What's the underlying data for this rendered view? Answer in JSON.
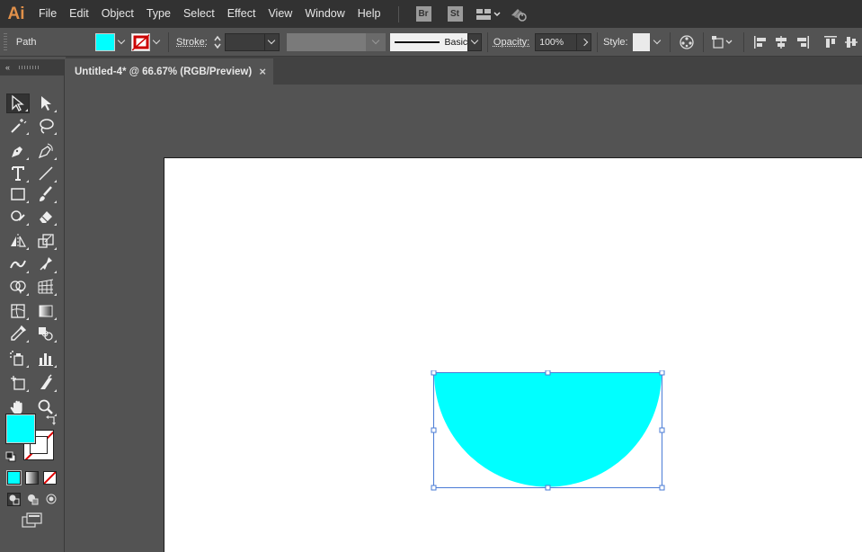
{
  "app": {
    "logo": "Ai"
  },
  "menu": [
    "File",
    "Edit",
    "Object",
    "Type",
    "Select",
    "Effect",
    "View",
    "Window",
    "Help"
  ],
  "menubar_icons": {
    "bridge": "Br",
    "stock": "St",
    "workspace": "arrange-documents-icon",
    "gpu": "gpu-performance-icon"
  },
  "control": {
    "selection_type": "Path",
    "fill_color": "#00FFFF",
    "stroke_label": "Stroke:",
    "stroke_weight": "",
    "brush_label": "Basic",
    "opacity_label": "Opacity:",
    "opacity_value": "100%",
    "style_label": "Style:"
  },
  "document": {
    "tab_title": "Untitled-4* @ 66.67% (RGB/Preview)",
    "close": "×"
  },
  "colors": {
    "fill": "#00FFFF",
    "stroke": "none",
    "ui_dark": "#323232",
    "ui_mid": "#535353",
    "selection": "#4a7bd6"
  },
  "toolbox": {
    "collapse": "«",
    "tools": [
      "selection-tool",
      "direct-selection-tool",
      "magic-wand-tool",
      "lasso-tool",
      "pen-tool",
      "curvature-tool",
      "type-tool",
      "line-segment-tool",
      "rectangle-tool",
      "paintbrush-tool",
      "shaper-tool",
      "eraser-tool",
      "reflect-tool",
      "scale-tool",
      "width-tool",
      "puppet-warp-tool",
      "shape-builder-tool",
      "perspective-grid-tool",
      "mesh-tool",
      "gradient-tool",
      "eyedropper-tool",
      "blend-tool",
      "symbol-sprayer-tool",
      "column-graph-tool",
      "artboard-tool",
      "slice-tool",
      "hand-tool",
      "zoom-tool"
    ]
  },
  "artwork": {
    "shape": "half-circle",
    "fill": "#00FFFF"
  }
}
